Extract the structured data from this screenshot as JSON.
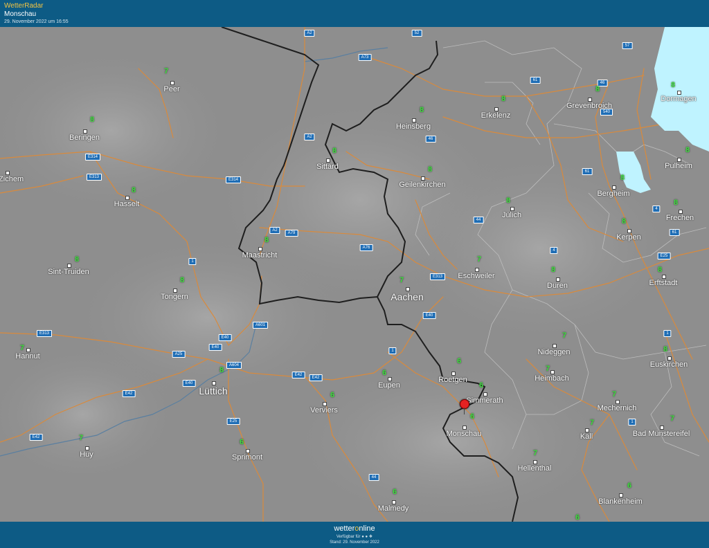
{
  "header": {
    "app_name": "WetterRadar",
    "location": "Monschau",
    "timestamp": "29. November 2022 um 16:55"
  },
  "footer": {
    "brand_prefix": "wetter",
    "brand_o": "o",
    "brand_suffix": "nline",
    "available": "Verfügbar für",
    "stand": "Stand: 29. November 2022"
  },
  "colors": {
    "header_bg": "#0d5b85",
    "accent": "#f4c542",
    "temp_text": "#3ee03e",
    "road": "#d98a3c",
    "border": "#222222",
    "river": "#5a7fa0",
    "precip": "#bff3ff"
  },
  "marker": {
    "icon": "red-pin-icon",
    "location": "Monschau"
  },
  "cities": [
    {
      "name": "Peer",
      "temp": "7"
    },
    {
      "name": "Beringen",
      "temp": "8"
    },
    {
      "name": "el-Zichem",
      "temp": ""
    },
    {
      "name": "Hasselt",
      "temp": "8"
    },
    {
      "name": "Sint-Truiden",
      "temp": "8"
    },
    {
      "name": "Tongern",
      "temp": "8"
    },
    {
      "name": "Hannut",
      "temp": "7"
    },
    {
      "name": "Lüttich",
      "temp": "8"
    },
    {
      "name": "Huy",
      "temp": "7"
    },
    {
      "name": "Sprimont",
      "temp": "6"
    },
    {
      "name": "Verviers",
      "temp": "6"
    },
    {
      "name": "Malmedy",
      "temp": "6"
    },
    {
      "name": "Eupen",
      "temp": "6"
    },
    {
      "name": "Maastricht",
      "temp": "8"
    },
    {
      "name": "Sittard",
      "temp": "8"
    },
    {
      "name": "Aachen",
      "temp": "7"
    },
    {
      "name": "Heinsberg",
      "temp": "8"
    },
    {
      "name": "Geilenkirchen",
      "temp": "8"
    },
    {
      "name": "Erkelenz",
      "temp": "8"
    },
    {
      "name": "Grevenbroich",
      "temp": "8"
    },
    {
      "name": "Dormagen",
      "temp": "8"
    },
    {
      "name": "Pulheim",
      "temp": "8"
    },
    {
      "name": "Bergheim",
      "temp": "8"
    },
    {
      "name": "Frechen",
      "temp": "8"
    },
    {
      "name": "Kerpen",
      "temp": "8"
    },
    {
      "name": "Jülich",
      "temp": "8"
    },
    {
      "name": "Eschweiler",
      "temp": "7"
    },
    {
      "name": "Düren",
      "temp": "8"
    },
    {
      "name": "Erftstadt",
      "temp": "8"
    },
    {
      "name": "Nideggen",
      "temp": "7"
    },
    {
      "name": "Euskirchen",
      "temp": "8"
    },
    {
      "name": "Roetgen",
      "temp": "6"
    },
    {
      "name": "Simmerath",
      "temp": "6"
    },
    {
      "name": "Heimbach",
      "temp": "7"
    },
    {
      "name": "Monschau",
      "temp": "6"
    },
    {
      "name": "Mechernich",
      "temp": "7"
    },
    {
      "name": "Kall",
      "temp": "7"
    },
    {
      "name": "Bad Münstereifel",
      "temp": "7"
    },
    {
      "name": "Hellenthal",
      "temp": "7"
    },
    {
      "name": "Blankenheim",
      "temp": "6"
    },
    {
      "name": "",
      "temp": "6"
    }
  ],
  "roads": [
    "A2",
    "A73",
    "52",
    "57",
    "61",
    "46",
    "540",
    "A2",
    "E314",
    "E313",
    "E314",
    "A2",
    "A79",
    "A76",
    "46",
    "61",
    "44",
    "4",
    "4",
    "E313",
    "1",
    "61",
    "E25",
    "A601",
    "E40",
    "E313",
    "E40",
    "A25",
    "A604",
    "E40",
    "E42",
    "E42",
    "E25",
    "E42",
    "E42",
    "44",
    "E40",
    "1",
    "1"
  ]
}
